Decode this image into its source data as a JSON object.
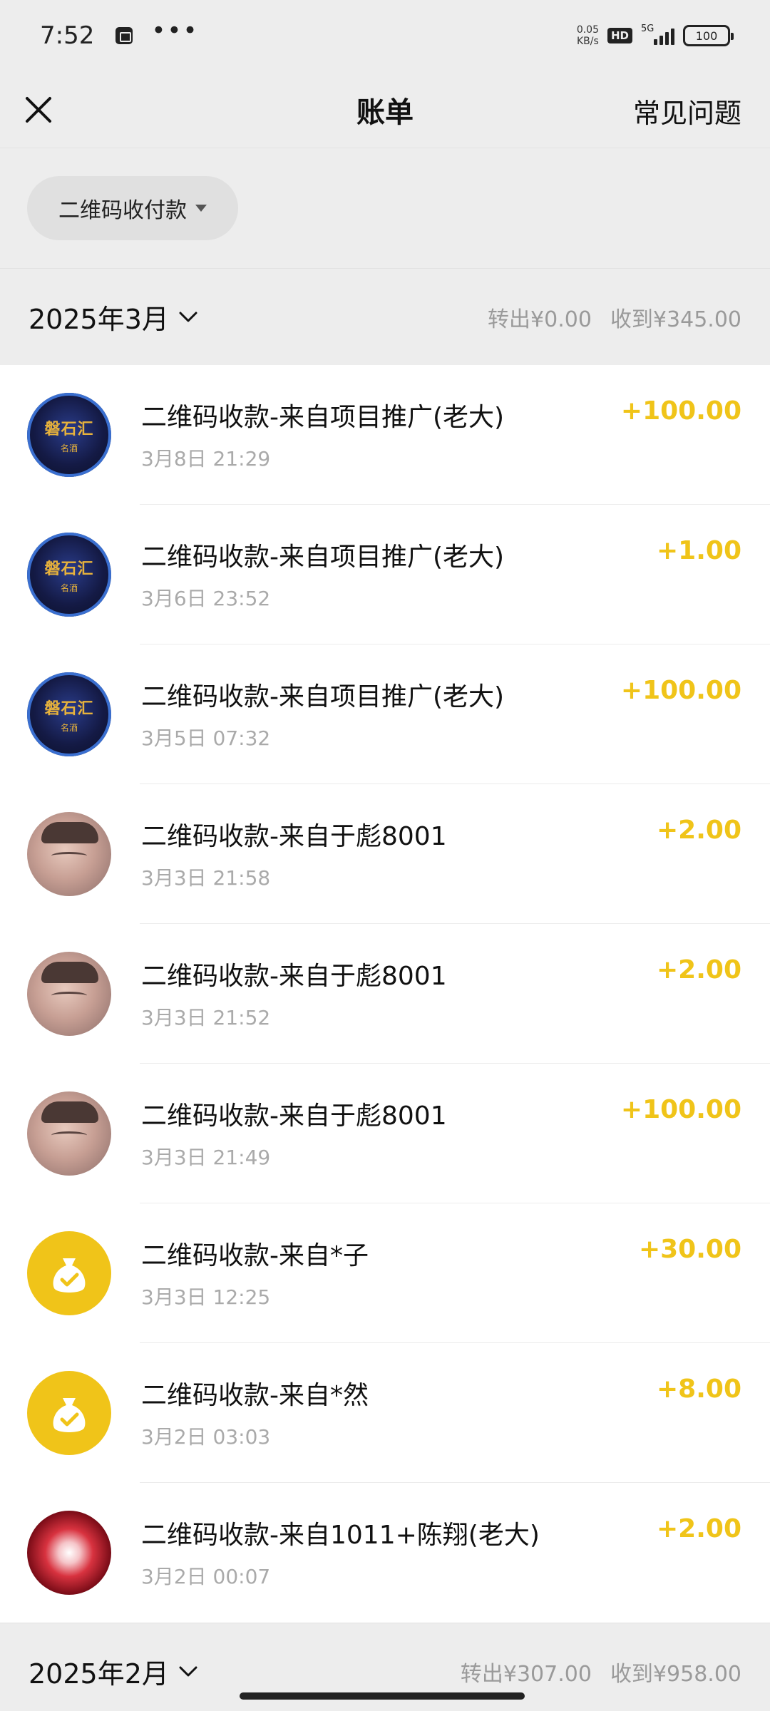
{
  "status_bar": {
    "time": "7:52",
    "net_speed_top": "0.05",
    "net_speed_bottom": "KB/s",
    "hd": "HD",
    "network": "5G",
    "battery": "100"
  },
  "header": {
    "title": "账单",
    "faq": "常见问题"
  },
  "filter": {
    "label": "二维码收付款"
  },
  "months": [
    {
      "label": "2025年3月",
      "out": "转出¥0.00",
      "in": "收到¥345.00"
    },
    {
      "label": "2025年2月",
      "out": "转出¥307.00",
      "in": "收到¥958.00"
    }
  ],
  "transactions": [
    {
      "title": "二维码收款-来自项目推广(老大)",
      "time": "3月8日 21:29",
      "amount": "+100.00",
      "avatar": "logo",
      "avatar_text1": "磐石汇",
      "avatar_text2": "名酒"
    },
    {
      "title": "二维码收款-来自项目推广(老大)",
      "time": "3月6日 23:52",
      "amount": "+1.00",
      "avatar": "logo",
      "avatar_text1": "磐石汇",
      "avatar_text2": "名酒"
    },
    {
      "title": "二维码收款-来自项目推广(老大)",
      "time": "3月5日 07:32",
      "amount": "+100.00",
      "avatar": "logo",
      "avatar_text1": "磐石汇",
      "avatar_text2": "名酒"
    },
    {
      "title": "二维码收款-来自于彪8001",
      "time": "3月3日 21:58",
      "amount": "+2.00",
      "avatar": "photo"
    },
    {
      "title": "二维码收款-来自于彪8001",
      "time": "3月3日 21:52",
      "amount": "+2.00",
      "avatar": "photo"
    },
    {
      "title": "二维码收款-来自于彪8001",
      "time": "3月3日 21:49",
      "amount": "+100.00",
      "avatar": "photo"
    },
    {
      "title": "二维码收款-来自*子",
      "time": "3月3日 12:25",
      "amount": "+30.00",
      "avatar": "money-bag"
    },
    {
      "title": "二维码收款-来自*然",
      "time": "3月2日 03:03",
      "amount": "+8.00",
      "avatar": "money-bag"
    },
    {
      "title": "二维码收款-来自1011+陈翔(老大)",
      "time": "3月2日 00:07",
      "amount": "+2.00",
      "avatar": "flower"
    }
  ],
  "colors": {
    "amount": "#f0c419",
    "background": "#ededed",
    "list_bg": "#ffffff"
  }
}
